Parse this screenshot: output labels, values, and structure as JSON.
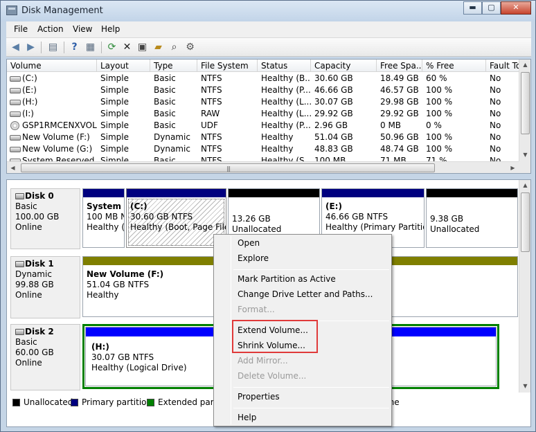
{
  "window": {
    "title": "Disk Management",
    "controls": {
      "minimize": "▬",
      "maximize": "▢",
      "close": "✕"
    }
  },
  "menubar": {
    "items": [
      "File",
      "Action",
      "View",
      "Help"
    ]
  },
  "toolbar": {
    "icons": [
      "back-arrow-icon",
      "forward-arrow-icon",
      "console-tree-icon",
      "help-icon",
      "properties-panel-icon",
      "refresh-icon",
      "delete-icon",
      "properties-icon",
      "open-folder-icon",
      "search-icon",
      "settings-icon"
    ]
  },
  "volume_list": {
    "columns": [
      "Volume",
      "Layout",
      "Type",
      "File System",
      "Status",
      "Capacity",
      "Free Spa...",
      "% Free",
      "Fault To"
    ],
    "rows": [
      [
        "(C:)",
        "Simple",
        "Basic",
        "NTFS",
        "Healthy (B...",
        "30.60 GB",
        "18.49 GB",
        "60 %",
        "No"
      ],
      [
        "(E:)",
        "Simple",
        "Basic",
        "NTFS",
        "Healthy (P...",
        "46.66 GB",
        "46.57 GB",
        "100 %",
        "No"
      ],
      [
        "(H:)",
        "Simple",
        "Basic",
        "NTFS",
        "Healthy (L...",
        "30.07 GB",
        "29.98 GB",
        "100 %",
        "No"
      ],
      [
        "(I:)",
        "Simple",
        "Basic",
        "RAW",
        "Healthy (L...",
        "29.92 GB",
        "29.92 GB",
        "100 %",
        "No"
      ],
      [
        "GSP1RMCENXVOL...",
        "Simple",
        "Basic",
        "UDF",
        "Healthy (P...",
        "2.96 GB",
        "0 MB",
        "0 %",
        "No"
      ],
      [
        "New Volume (F:)",
        "Simple",
        "Dynamic",
        "NTFS",
        "Healthy",
        "51.04 GB",
        "50.96 GB",
        "100 %",
        "No"
      ],
      [
        "New Volume (G:)",
        "Simple",
        "Dynamic",
        "NTFS",
        "Healthy",
        "48.83 GB",
        "48.74 GB",
        "100 %",
        "No"
      ],
      [
        "System Reserved",
        "Simple",
        "Basic",
        "NTFS",
        "Healthy (S...",
        "100 MB",
        "71 MB",
        "71 %",
        "No"
      ]
    ]
  },
  "disks": [
    {
      "name": "Disk 0",
      "type": "Basic",
      "size": "100.00 GB",
      "status": "Online",
      "partitions": [
        {
          "name": "System R",
          "size": "100 MB N",
          "status": "Healthy (",
          "kind": "primary"
        },
        {
          "name": "(C:)",
          "size": "30.60 GB NTFS",
          "status": "Healthy (Boot, Page File,",
          "kind": "primary-selected"
        },
        {
          "name": "",
          "size": "13.26 GB",
          "status": "Unallocated",
          "kind": "unallocated"
        },
        {
          "name": "(E:)",
          "size": "46.66 GB NTFS",
          "status": "Healthy (Primary Partition",
          "kind": "primary"
        },
        {
          "name": "",
          "size": "9.38 GB",
          "status": "Unallocated",
          "kind": "unallocated"
        }
      ]
    },
    {
      "name": "Disk 1",
      "type": "Dynamic",
      "size": "99.88 GB",
      "status": "Online",
      "partitions": [
        {
          "name": "New Volume (F:)",
          "size": "51.04 GB NTFS",
          "status": "Healthy",
          "kind": "simple"
        }
      ]
    },
    {
      "name": "Disk 2",
      "type": "Basic",
      "size": "60.00 GB",
      "status": "Online",
      "partitions": [
        {
          "name": "(H:)",
          "size": "30.07 GB NTFS",
          "status": "Healthy (Logical Drive)",
          "kind": "logical"
        }
      ]
    }
  ],
  "legend": {
    "items": [
      {
        "label": "Unallocated",
        "color": "#000000"
      },
      {
        "label": "Primary partition",
        "color": "#00007f"
      },
      {
        "label": "Extended partit",
        "color": "#008000"
      },
      {
        "label": "ume",
        "color": ""
      }
    ]
  },
  "context_menu": {
    "items": [
      {
        "label": "Open",
        "enabled": true
      },
      {
        "label": "Explore",
        "enabled": true
      },
      {
        "label": "Mark Partition as Active",
        "enabled": true
      },
      {
        "label": "Change Drive Letter and Paths...",
        "enabled": true
      },
      {
        "label": "Format...",
        "enabled": false
      },
      {
        "label": "Extend Volume...",
        "enabled": true
      },
      {
        "label": "Shrink Volume...",
        "enabled": true
      },
      {
        "label": "Add Mirror...",
        "enabled": false
      },
      {
        "label": "Delete Volume...",
        "enabled": false
      },
      {
        "label": "Properties",
        "enabled": true
      },
      {
        "label": "Help",
        "enabled": true
      }
    ]
  },
  "colors": {
    "primary": "#00007f",
    "unallocated": "#000000",
    "simple": "#7f7f00",
    "extended": "#008000",
    "logical": "#0000ff",
    "highlight": "#e03a3a"
  }
}
